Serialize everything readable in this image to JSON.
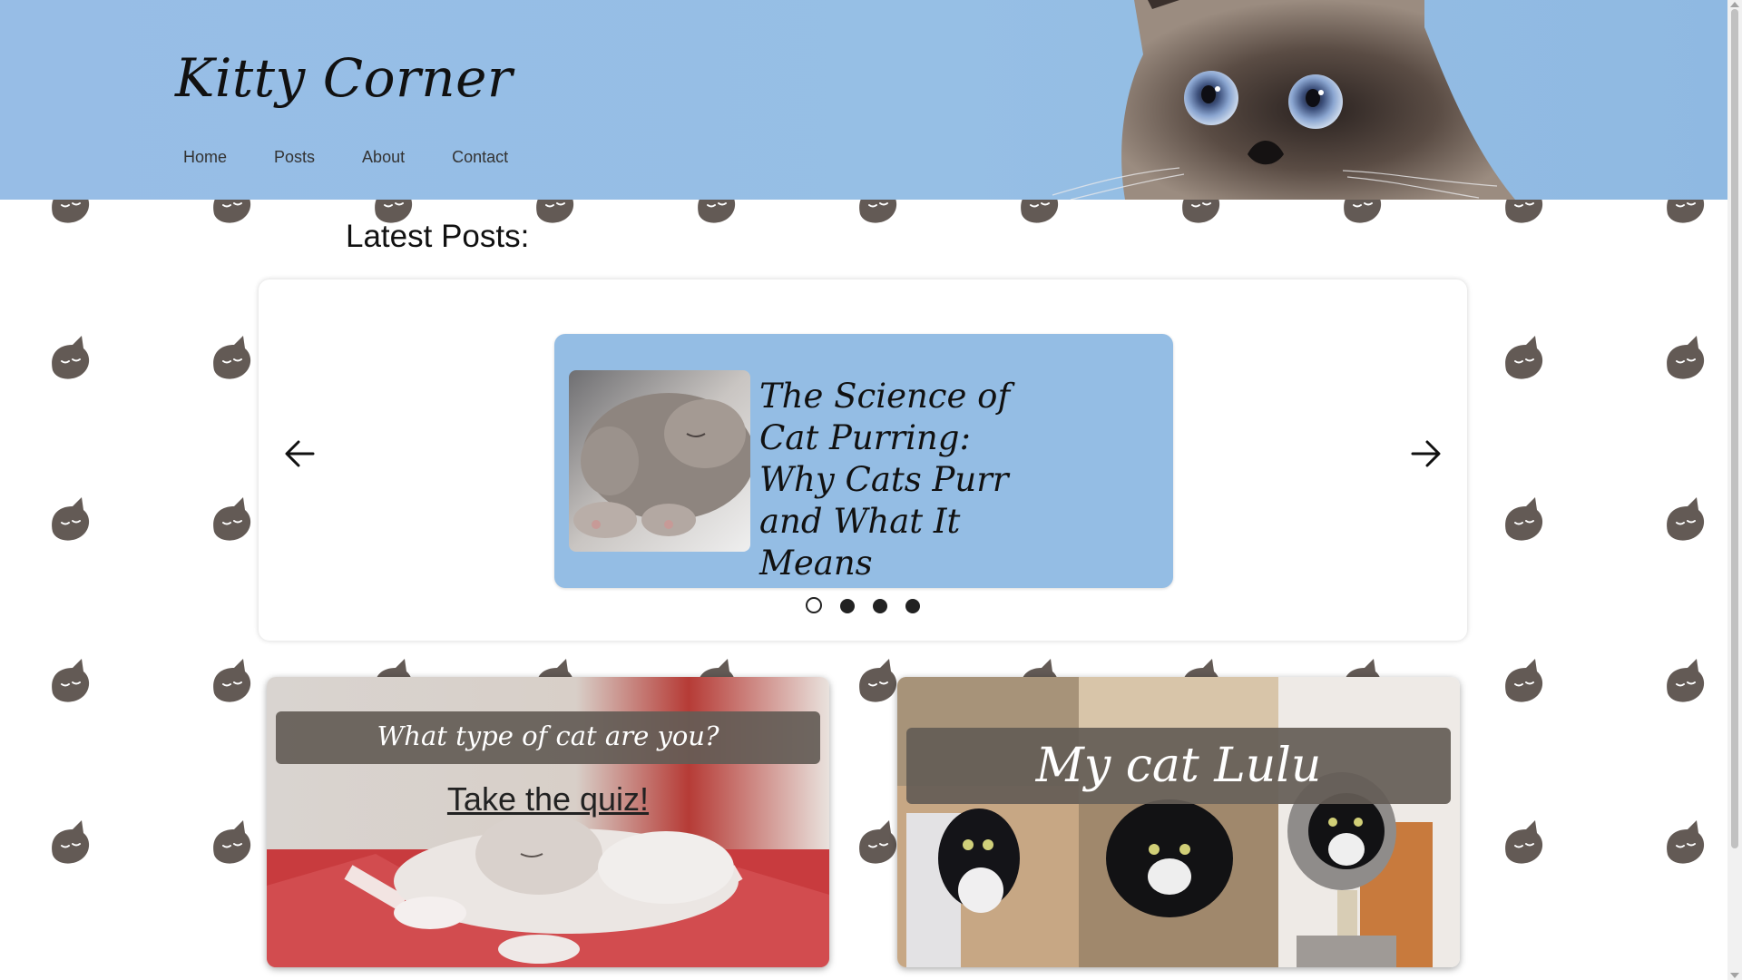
{
  "site": {
    "brand": "Kitty Corner",
    "nav": [
      "Home",
      "Posts",
      "About",
      "Contact"
    ]
  },
  "latest": {
    "heading": "Latest Posts:",
    "slide_title": "The Science of Cat Purring: Why Cats Purr and What It Means",
    "dots_count": 4,
    "active_dot": 1
  },
  "cards": {
    "quiz": {
      "title": "What type of cat are you?",
      "link": "Take the quiz!"
    },
    "lulu": {
      "title": "My cat Lulu"
    }
  },
  "colors": {
    "header_bg": "#97bde6",
    "slide_bg": "#94bde4",
    "cat_icon": "#635a55",
    "overlay_band": "#645c56"
  },
  "icons": {
    "prev": "arrow-left-icon",
    "next": "arrow-right-icon",
    "pattern": "cat-head-icon"
  }
}
